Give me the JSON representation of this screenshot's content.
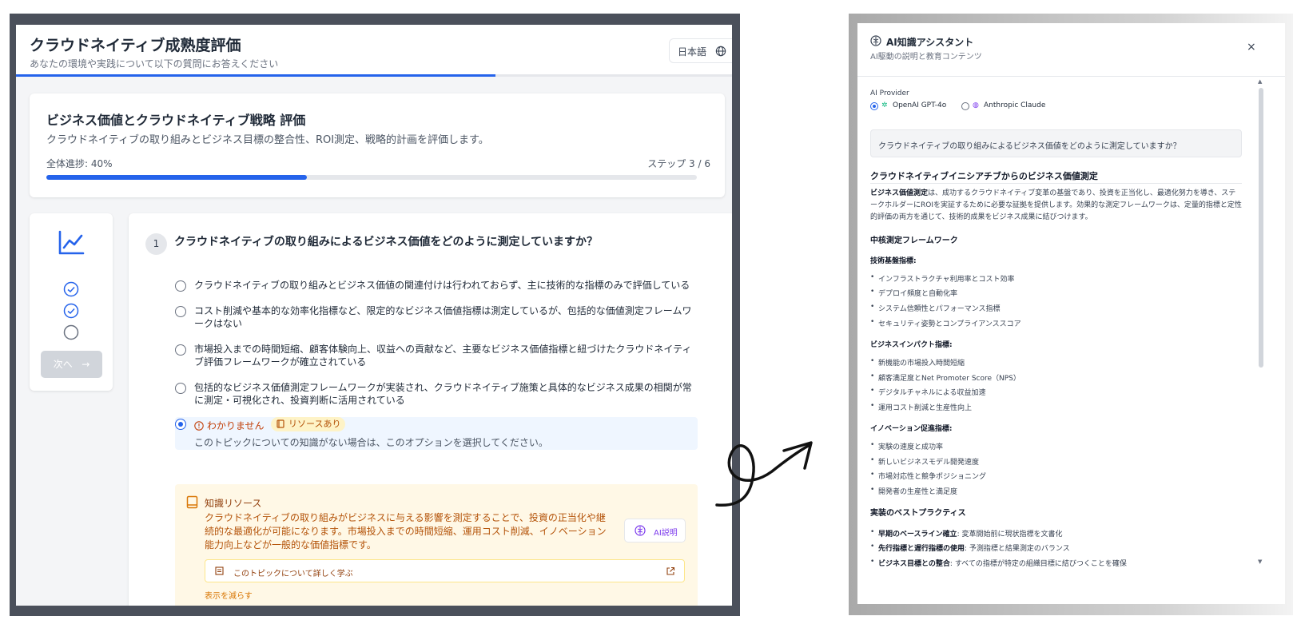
{
  "app": {
    "title": "クラウドネイティブ成熟度評価",
    "subtitle": "あなたの環境や実践について以下の質問にお答えください",
    "language": "日本語",
    "header_progress": 0.67
  },
  "section": {
    "title": "ビジネス価値とクラウドネイティブ戦略 評価",
    "description": "クラウドネイティブの取り組みとビジネス目標の整合性、ROI測定、戦略的計画を評価します。",
    "overall_progress_label": "全体進捗: 40%",
    "overall_progress": 0.4,
    "step_label": "ステップ 3 / 6"
  },
  "sidebar": {
    "steps": [
      "complete",
      "complete",
      "incomplete"
    ],
    "next_label": "次へ",
    "next_arrow": "→"
  },
  "question": {
    "number": "1",
    "text": "クラウドネイティブの取り組みによるビジネス価値をどのように測定していますか？",
    "options": [
      "クラウドネイティブの取り組みとビジネス価値の関連付けは行われておらず、主に技術的な指標のみで評価している",
      "コスト削減や基本的な効率化指標など、限定的なビジネス価値指標は測定しているが、包括的な価値測定フレームワークはない",
      "市場投入までの時間短縮、顧客体験向上、収益への貢献など、主要なビジネス価値指標と紐づけたクラウドネイティブ評価フレームワークが確立されている",
      "包括的なビジネス価値測定フレームワークが実装され、クラウドネイティブ施策と具体的なビジネス成果の相関が常に測定・可視化され、投資判断に活用されている"
    ],
    "unknown_label": "わかりません",
    "resource_badge": "リソースあり",
    "unknown_hint": "このトピックについての知識がない場合は、このオプションを選択してください。",
    "selected_index": 4
  },
  "resource": {
    "title": "知識リソース",
    "description": "クラウドネイティブの取り組みがビジネスに与える影響を測定することで、投資の正当化や継続的な最適化が可能になります。市場投入までの時間短縮、運用コスト削減、イノベーション能力向上などが一般的な価値指標です。",
    "ai_button": "AI説明",
    "learn_more": "このトピックについて詳しく学ぶ",
    "show_less": "表示を減らす"
  },
  "panel": {
    "title": "AI知識アシスタント",
    "subtitle": "AI駆動の説明と教育コンテンツ",
    "close": "×",
    "provider_label": "AI Provider",
    "providers": [
      {
        "name": "OpenAI GPT-4o",
        "selected": true
      },
      {
        "name": "Anthropic Claude",
        "selected": false
      }
    ],
    "question": "クラウドネイティブの取り組みによるビジネス価値をどのように測定していますか？",
    "heading": "クラウドネイティブイニシアチブからのビジネス価値測定",
    "intro_bold": "ビジネス価値測定",
    "intro_rest": "は、成功するクラウドネイティブ変革の基盤であり、投資を正当化し、最適化努力を導き、ステークホルダーにROIを実証するために必要な証拠を提供します。効果的な測定フレームワークは、定量的指標と定性的評価の両方を通じて、技術的成果をビジネス成果に結びつけます。",
    "framework_heading": "中核測定フレームワーク",
    "groups": [
      {
        "title": "技術基盤指標:",
        "items": [
          "インフラストラクチャ利用率とコスト効率",
          "デプロイ頻度と自動化率",
          "システム信頼性とパフォーマンス指標",
          "セキュリティ姿勢とコンプライアンススコア"
        ]
      },
      {
        "title": "ビジネスインパクト指標:",
        "items": [
          "新機能の市場投入時間短縮",
          "顧客満足度とNet Promoter Score（NPS）",
          "デジタルチャネルによる収益加速",
          "運用コスト削減と生産性向上"
        ]
      },
      {
        "title": "イノベーション促進指標:",
        "items": [
          "実験の速度と成功率",
          "新しいビジネスモデル開発速度",
          "市場対応性と競争ポジショニング",
          "開発者の生産性と満足度"
        ]
      }
    ],
    "practices_heading": "実装のベストプラクティス",
    "practices": [
      {
        "bold": "早期のベースライン確立",
        "rest": ": 変革開始前に現状指標を文書化"
      },
      {
        "bold": "先行指標と遅行指標の使用",
        "rest": ": 予測指標と結果測定のバランス"
      },
      {
        "bold": "ビジネス目標との整合",
        "rest": ": すべての指標が特定の組織目標に結びつくことを確保"
      }
    ]
  },
  "colors": {
    "accent": "#2563eb",
    "warning": "#d97706",
    "ai_purple": "#7c3aed"
  }
}
